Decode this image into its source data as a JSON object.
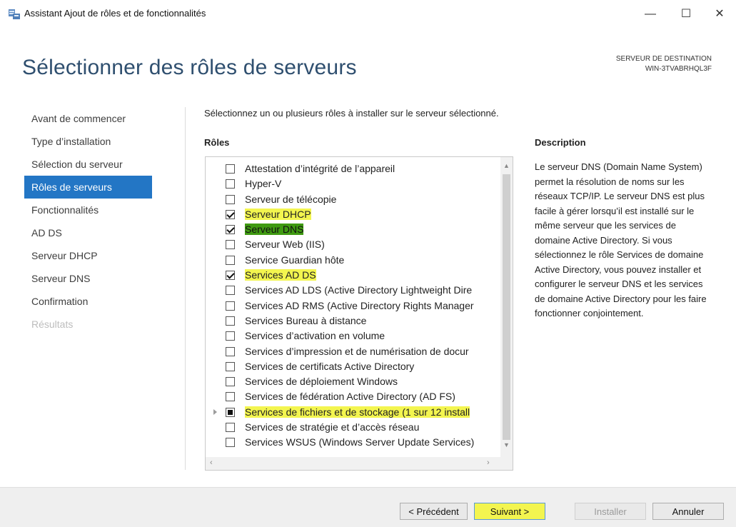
{
  "window": {
    "title": "Assistant Ajout de rôles et de fonctionnalités",
    "min_icon": "—",
    "max_icon": "☐",
    "close_icon": "✕"
  },
  "header": {
    "page_title": "Sélectionner des rôles de serveurs",
    "destination_label": "SERVEUR DE DESTINATION",
    "destination_name": "WIN-3TVABRHQL3F"
  },
  "nav": {
    "items": [
      {
        "label": "Avant de commencer",
        "state": "normal"
      },
      {
        "label": "Type d’installation",
        "state": "normal"
      },
      {
        "label": "Sélection du serveur",
        "state": "normal"
      },
      {
        "label": "Rôles de serveurs",
        "state": "active"
      },
      {
        "label": "Fonctionnalités",
        "state": "normal"
      },
      {
        "label": "AD DS",
        "state": "normal"
      },
      {
        "label": "Serveur DHCP",
        "state": "normal"
      },
      {
        "label": "Serveur DNS",
        "state": "normal"
      },
      {
        "label": "Confirmation",
        "state": "normal"
      },
      {
        "label": "Résultats",
        "state": "disabled"
      }
    ]
  },
  "main": {
    "instruction": "Sélectionnez un ou plusieurs rôles à installer sur le serveur sélectionné.",
    "roles_header": "Rôles",
    "roles": [
      {
        "label": "Attestation d’intégrité de l’appareil",
        "checked": false
      },
      {
        "label": "Hyper-V",
        "checked": false
      },
      {
        "label": "Serveur de télécopie",
        "checked": false
      },
      {
        "label": "Serveur DHCP",
        "checked": true
      },
      {
        "label": "Serveur DNS",
        "checked": true
      },
      {
        "label": "Serveur Web (IIS)",
        "checked": false
      },
      {
        "label": "Service Guardian hôte",
        "checked": false
      },
      {
        "label": "Services AD DS",
        "checked": true
      },
      {
        "label": "Services AD LDS (Active Directory Lightweight Dire",
        "checked": false
      },
      {
        "label": "Services AD RMS (Active Directory Rights Manager",
        "checked": false
      },
      {
        "label": "Services Bureau à distance",
        "checked": false
      },
      {
        "label": "Services d’activation en volume",
        "checked": false
      },
      {
        "label": "Services d’impression et de numérisation de docur",
        "checked": false
      },
      {
        "label": "Services de certificats Active Directory",
        "checked": false
      },
      {
        "label": "Services de déploiement Windows",
        "checked": false
      },
      {
        "label": "Services de fédération Active Directory (AD FS)",
        "checked": false
      },
      {
        "label": "Services de fichiers et de stockage (1 sur 12 install",
        "checked": "partial",
        "expandable": true
      },
      {
        "label": "Services de stratégie et d’accès réseau",
        "checked": false
      },
      {
        "label": "Services WSUS (Windows Server Update Services)",
        "checked": false
      }
    ],
    "description_header": "Description",
    "description_text": "Le serveur DNS (Domain Name System) permet la résolution de noms sur les réseaux TCP/IP. Le serveur DNS est plus facile à gérer lorsqu’il est installé sur le même serveur que les services de domaine Active Directory. Si vous sélectionnez le rôle Services de domaine Active Directory, vous pouvez installer et configurer le serveur DNS et les services de domaine Active Directory pour les faire fonctionner conjointement."
  },
  "footer": {
    "prev_label": "< Précédent",
    "next_label": "Suivant >",
    "install_label": "Installer",
    "cancel_label": "Annuler"
  },
  "colors": {
    "accent": "#2376c5",
    "highlight": "#f3f54f"
  }
}
